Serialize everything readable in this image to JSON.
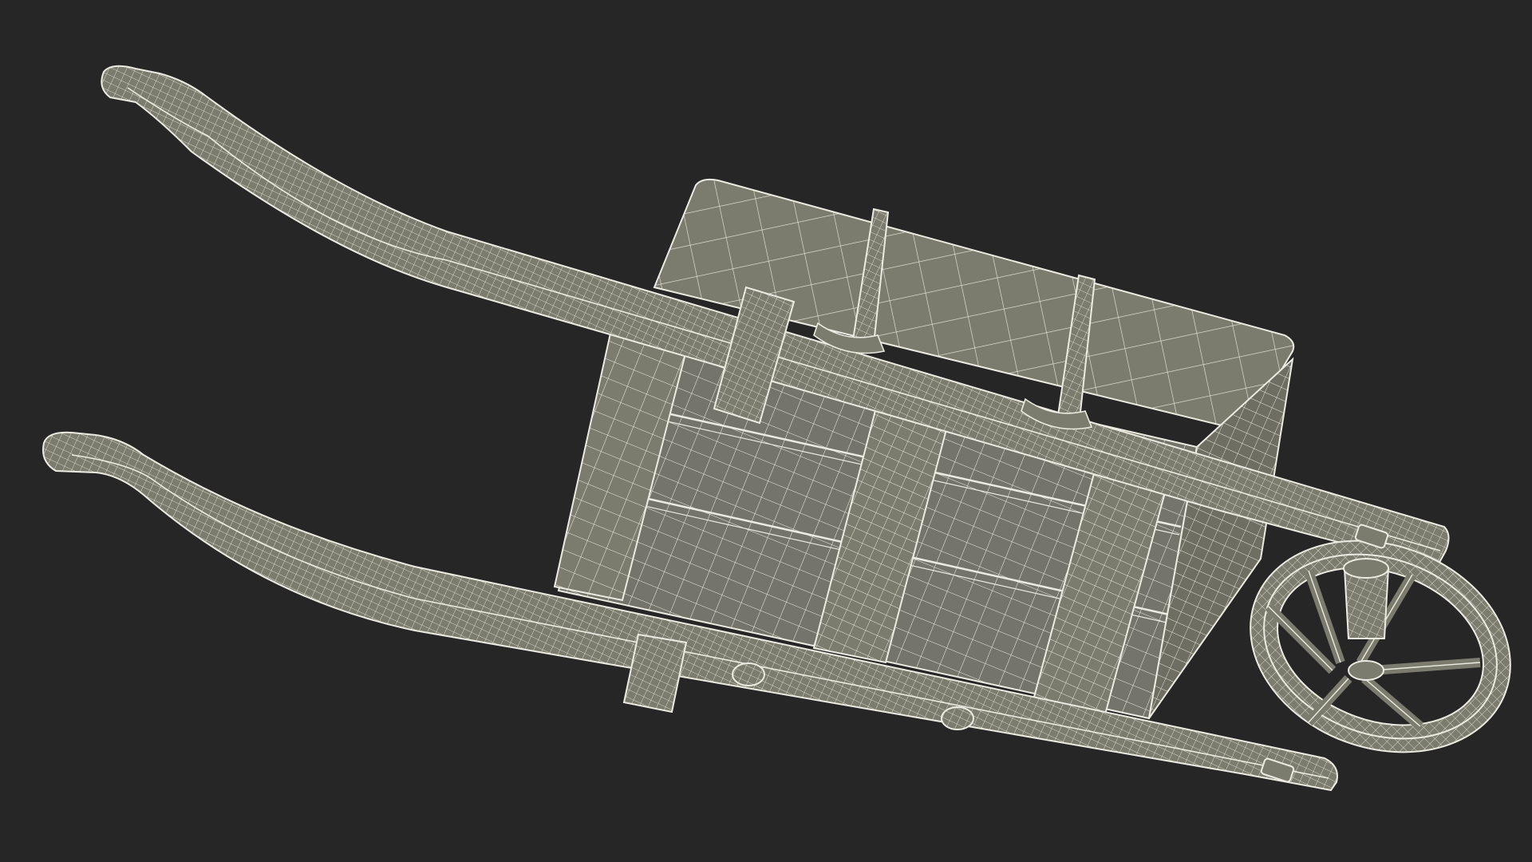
{
  "scene": {
    "background_color": "#262626",
    "model_fill_color": "#7c7c6e",
    "model_shadow_color": "#5f5f54",
    "wireframe_color": "#ecebe1",
    "subject": "wheelbarrow-wireframe-render"
  }
}
